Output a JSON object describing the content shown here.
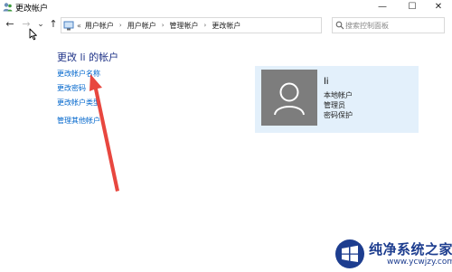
{
  "window": {
    "title": "更改帐户",
    "min_glyph": "—",
    "max_glyph": "☐",
    "close_glyph": "✕"
  },
  "nav": {
    "back_glyph": "←",
    "forward_glyph": "→",
    "recent_glyph": "⌄",
    "up_glyph": "↑",
    "breadcrumb_lead": "«",
    "breadcrumbs": [
      "用户帐户",
      "用户帐户",
      "管理帐户",
      "更改帐户"
    ],
    "breadcrumb_separator": "›",
    "dropdown_glyph": "⌄",
    "refresh_glyph": "↻",
    "search_placeholder": "搜索控制面板"
  },
  "main": {
    "heading": "更改 li 的帐户",
    "links": [
      "更改帐户名称",
      "更改密码",
      "更改帐户类型",
      "管理其他帐户"
    ]
  },
  "account": {
    "name": "li",
    "details": [
      "本地帐户",
      "管理员",
      "密码保护"
    ]
  },
  "annotation": {
    "arrow_color": "#e8473f"
  },
  "watermark": {
    "brand": "纯净系统之家",
    "url": "www.ycwjzy.com",
    "blue": "#1d3d8f"
  }
}
